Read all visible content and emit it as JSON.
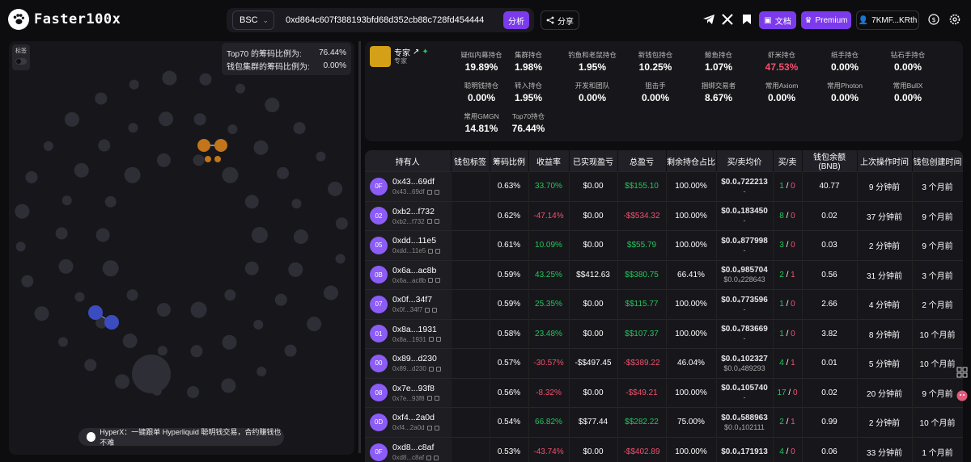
{
  "header": {
    "logo_text": "Faster100x",
    "chain": "BSC",
    "address": "0xd864c607f388193bfd68d352cb88c728fd454444",
    "analyze_label": "分析",
    "share_label": "分享",
    "docs_label": "文档",
    "premium_label": "Premium",
    "wallet_label": "7KMF...KRth",
    "icons": [
      "telegram-icon",
      "x-icon",
      "bookmark-icon",
      "dollar-icon",
      "gear-icon"
    ]
  },
  "bubble_panel": {
    "label_toggle": "标签",
    "top70_label": "Top70 的筹码比例为:",
    "top70_value": "76.44%",
    "cluster_label": "钱包集群的筹码比例为:",
    "cluster_value": "0.00%",
    "hyperx_text": "HyperX：一键跟单 Hyperliquid 聪明钱交易，合约赚钱也不难"
  },
  "expert": {
    "name": "专家",
    "sub": "专家"
  },
  "stats": [
    {
      "label": "疑似内幕持仓",
      "value": "19.89%",
      "red": false
    },
    {
      "label": "集群持仓",
      "value": "1.98%",
      "red": false
    },
    {
      "label": "钓鱼和老鼠持仓",
      "value": "1.95%",
      "red": false
    },
    {
      "label": "新钱包持仓",
      "value": "10.25%",
      "red": false
    },
    {
      "label": "鲸鱼持仓",
      "value": "1.07%",
      "red": false
    },
    {
      "label": "虾米持仓",
      "value": "47.53%",
      "red": true
    },
    {
      "label": "纸手持仓",
      "value": "0.00%",
      "red": false
    },
    {
      "label": "钻石手持仓",
      "value": "0.00%",
      "red": false
    },
    {
      "label": "聪明钱持仓",
      "value": "0.00%",
      "red": false
    },
    {
      "label": "转入持仓",
      "value": "1.95%",
      "red": false
    },
    {
      "label": "开发和团队",
      "value": "0.00%",
      "red": false
    },
    {
      "label": "狙击手",
      "value": "0.00%",
      "red": false
    },
    {
      "label": "捆绑交易者",
      "value": "8.67%",
      "red": false
    },
    {
      "label": "常用Axiom",
      "value": "0.00%",
      "red": false
    },
    {
      "label": "常用Photon",
      "value": "0.00%",
      "red": false
    },
    {
      "label": "常用BullX",
      "value": "0.00%",
      "red": false
    },
    {
      "label": "常用GMGN",
      "value": "14.81%",
      "red": false
    },
    {
      "label": "Top70持仓",
      "value": "76.44%",
      "red": false
    }
  ],
  "table": {
    "headers": [
      "持有人",
      "钱包标签",
      "筹码比例",
      "收益率",
      "已实现盈亏",
      "总盈亏",
      "剩余持仓占比",
      "买/卖均价",
      "买/卖",
      "钱包余额(BNB)",
      "上次操作时间",
      "钱包创建时间"
    ],
    "rows": [
      {
        "badge": "0F",
        "addr": "0x43...69df",
        "sub": "0x43...69df",
        "ratio": "0.63%",
        "roi": "33.70%",
        "roi_c": "g",
        "realized": "$0.00",
        "realized_c": "w",
        "total": "$$155.10",
        "total_c": "g",
        "remain": "100.00%",
        "buy_price": "$0.0₄722213",
        "sell_price": "-",
        "buys": "1",
        "sells": "0",
        "balance": "40.77",
        "last": "9 分钟前",
        "created": "3 个月前"
      },
      {
        "badge": "02",
        "addr": "0xb2...f732",
        "sub": "0xb2...f732",
        "ratio": "0.62%",
        "roi": "-47.14%",
        "roi_c": "r",
        "realized": "$0.00",
        "realized_c": "w",
        "total": "-$$534.32",
        "total_c": "r",
        "remain": "100.00%",
        "buy_price": "$0.0₄183450",
        "sell_price": "-",
        "buys": "8",
        "sells": "0",
        "balance": "0.02",
        "last": "37 分钟前",
        "created": "9 个月前"
      },
      {
        "badge": "05",
        "addr": "0xdd...11e5",
        "sub": "0xdd...11e5",
        "ratio": "0.61%",
        "roi": "10.09%",
        "roi_c": "g",
        "realized": "$0.00",
        "realized_c": "w",
        "total": "$$55.79",
        "total_c": "g",
        "remain": "100.00%",
        "buy_price": "$0.0₄877998",
        "sell_price": "-",
        "buys": "3",
        "sells": "0",
        "balance": "0.03",
        "last": "2 分钟前",
        "created": "9 个月前"
      },
      {
        "badge": "0B",
        "addr": "0x6a...ac8b",
        "sub": "0x6a...ac8b",
        "ratio": "0.59%",
        "roi": "43.25%",
        "roi_c": "g",
        "realized": "$$412.63",
        "realized_c": "w",
        "total": "$$380.75",
        "total_c": "g",
        "remain": "66.41%",
        "buy_price": "$0.0₄985704",
        "sell_price": "$0.0₄228643",
        "buys": "2",
        "sells": "1",
        "balance": "0.56",
        "last": "31 分钟前",
        "created": "3 个月前"
      },
      {
        "badge": "07",
        "addr": "0x0f...34f7",
        "sub": "0x0f...34f7",
        "ratio": "0.59%",
        "roi": "25.35%",
        "roi_c": "g",
        "realized": "$0.00",
        "realized_c": "w",
        "total": "$$115.77",
        "total_c": "g",
        "remain": "100.00%",
        "buy_price": "$0.0₄773596",
        "sell_price": "-",
        "buys": "1",
        "sells": "0",
        "balance": "2.66",
        "last": "4 分钟前",
        "created": "2 个月前"
      },
      {
        "badge": "01",
        "addr": "0x8a...1931",
        "sub": "0x8a...1931",
        "ratio": "0.58%",
        "roi": "23.48%",
        "roi_c": "g",
        "realized": "$0.00",
        "realized_c": "w",
        "total": "$$107.37",
        "total_c": "g",
        "remain": "100.00%",
        "buy_price": "$0.0₄783669",
        "sell_price": "-",
        "buys": "1",
        "sells": "0",
        "balance": "3.82",
        "last": "8 分钟前",
        "created": "10 个月前"
      },
      {
        "badge": "00",
        "addr": "0x89...d230",
        "sub": "0x89...d230",
        "ratio": "0.57%",
        "roi": "-30.57%",
        "roi_c": "r",
        "realized": "-$$497.45",
        "realized_c": "w",
        "total": "-$$389.22",
        "total_c": "r",
        "remain": "46.04%",
        "buy_price": "$0.0₄102327",
        "sell_price": "$0.0₄489293",
        "buys": "4",
        "sells": "1",
        "balance": "0.01",
        "last": "5 分钟前",
        "created": "10 个月前"
      },
      {
        "badge": "08",
        "addr": "0x7e...93f8",
        "sub": "0x7e...93f8",
        "ratio": "0.56%",
        "roi": "-8.32%",
        "roi_c": "r",
        "realized": "$0.00",
        "realized_c": "w",
        "total": "-$$49.21",
        "total_c": "r",
        "remain": "100.00%",
        "buy_price": "$0.0₄105740",
        "sell_price": "-",
        "buys": "17",
        "sells": "0",
        "balance": "0.02",
        "last": "20 分钟前",
        "created": "9 个月前"
      },
      {
        "badge": "0D",
        "addr": "0xf4...2a0d",
        "sub": "0xf4...2a0d",
        "ratio": "0.54%",
        "roi": "66.82%",
        "roi_c": "g",
        "realized": "$$77.44",
        "realized_c": "w",
        "total": "$$282.22",
        "total_c": "g",
        "remain": "75.00%",
        "buy_price": "$0.0₄588963",
        "sell_price": "$0.0₄102111",
        "buys": "2",
        "sells": "1",
        "balance": "0.99",
        "last": "2 分钟前",
        "created": "10 个月前"
      },
      {
        "badge": "0F",
        "addr": "0xd8...c8af",
        "sub": "0xd8...c8af",
        "ratio": "0.53%",
        "roi": "-43.74%",
        "roi_c": "r",
        "realized": "$0.00",
        "realized_c": "w",
        "total": "-$$402.89",
        "total_c": "r",
        "remain": "100.00%",
        "buy_price": "$0.0₄171913",
        "sell_price": "",
        "buys": "4",
        "sells": "0",
        "balance": "0.06",
        "last": "33 分钟前",
        "created": "1 个月前"
      }
    ]
  },
  "colors": {
    "accent": "#7c3aed",
    "green": "#22c55e",
    "red": "#f0506e",
    "bubble": "#2e2e36",
    "bubble_orange": "#c2751a",
    "bubble_blue": "#3b4cc0"
  }
}
